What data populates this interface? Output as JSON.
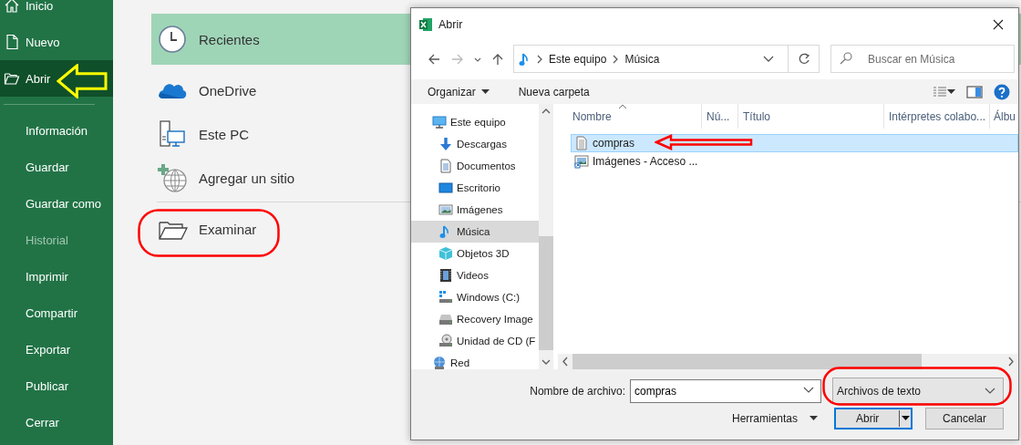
{
  "sidebar": {
    "top_items": [
      {
        "label": "Inicio",
        "selected": false
      },
      {
        "label": "Nuevo",
        "selected": false
      },
      {
        "label": "Abrir",
        "selected": true
      }
    ],
    "items": [
      {
        "label": "Información",
        "disabled": false
      },
      {
        "label": "Guardar",
        "disabled": false
      },
      {
        "label": "Guardar como",
        "disabled": false
      },
      {
        "label": "Historial",
        "disabled": true
      },
      {
        "label": "Imprimir",
        "disabled": false
      },
      {
        "label": "Compartir",
        "disabled": false
      },
      {
        "label": "Exportar",
        "disabled": false
      },
      {
        "label": "Publicar",
        "disabled": false
      },
      {
        "label": "Cerrar",
        "disabled": false
      }
    ]
  },
  "backstage": {
    "locations": [
      {
        "label": "Recientes",
        "selected": true
      },
      {
        "label": "OneDrive",
        "selected": false
      },
      {
        "label": "Este PC",
        "selected": false
      },
      {
        "label": "Agregar un sitio",
        "selected": false
      }
    ],
    "browse": {
      "label": "Examinar"
    }
  },
  "dialog": {
    "title": "Abrir",
    "breadcrumb": [
      "Este equipo",
      "Música"
    ],
    "search": {
      "placeholder": "Buscar en Música"
    },
    "toolbar": {
      "organize": "Organizar",
      "new_folder": "Nueva carpeta"
    },
    "nav_tree": [
      {
        "label": "Este equipo",
        "selected": false,
        "children": [
          {
            "label": "Descargas",
            "selected": false
          },
          {
            "label": "Documentos",
            "selected": false
          },
          {
            "label": "Escritorio",
            "selected": false
          },
          {
            "label": "Imágenes",
            "selected": false
          },
          {
            "label": "Música",
            "selected": true
          },
          {
            "label": "Objetos 3D",
            "selected": false
          },
          {
            "label": "Videos",
            "selected": false
          },
          {
            "label": "Windows (C:)",
            "selected": false
          },
          {
            "label": "Recovery Image",
            "selected": false
          },
          {
            "label": "Unidad de CD (F",
            "selected": false
          }
        ]
      },
      {
        "label": "Red",
        "selected": false
      }
    ],
    "columns": [
      "Nombre",
      "Nú...",
      "Título",
      "Intérpretes colabo...",
      "Álbu"
    ],
    "files": [
      {
        "name": "compras",
        "selected": true
      },
      {
        "name": "Imágenes - Acceso ...",
        "selected": false
      }
    ],
    "file_name": {
      "label": "Nombre de archivo:",
      "value": "compras"
    },
    "file_type": "Archivos de texto",
    "tools": "Herramientas",
    "buttons": [
      {
        "label": "Abrir",
        "kind": "split",
        "default": true
      },
      {
        "label": "Cancelar",
        "kind": "plain",
        "default": false
      }
    ]
  },
  "annotations": [
    {
      "kind": "arrow",
      "color": "#ffff00"
    },
    {
      "kind": "ellipse",
      "color": "#ff0000"
    },
    {
      "kind": "arrow",
      "color": "#ff0000"
    },
    {
      "kind": "ellipse",
      "color": "#ff0000"
    }
  ]
}
